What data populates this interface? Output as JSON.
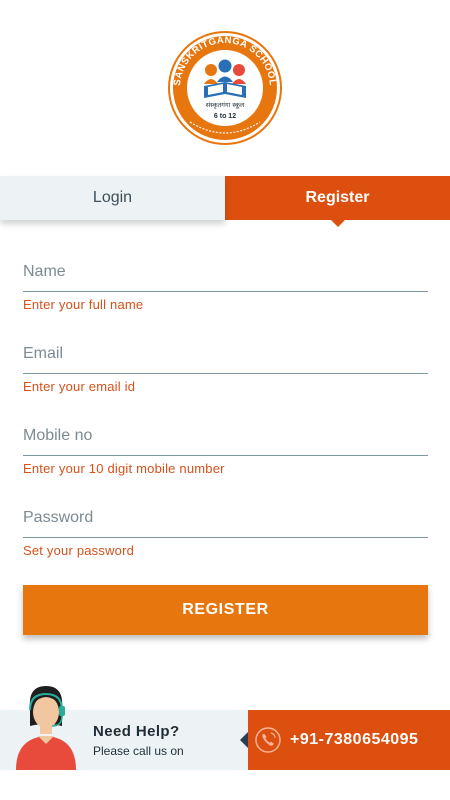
{
  "logo": {
    "ring_text": "SANSKRITGANGA SCHOOL",
    "hindi_name": "संस्कृतगंगा स्कूल",
    "grades": "6 to 12",
    "colors": {
      "ring": "#e8760f",
      "blue": "#2a6fb5"
    }
  },
  "tabs": [
    {
      "label": "Login",
      "active": false
    },
    {
      "label": "Register",
      "active": true
    }
  ],
  "form": {
    "fields": [
      {
        "placeholder": "Name",
        "value": "",
        "hint": "Enter your full name"
      },
      {
        "placeholder": "Email",
        "value": "",
        "hint": "Enter your email id"
      },
      {
        "placeholder": "Mobile no",
        "value": "",
        "hint": "Enter your 10 digit mobile number"
      },
      {
        "placeholder": "Password",
        "value": "",
        "hint": "Set your password"
      }
    ],
    "submit_label": "REGISTER"
  },
  "help": {
    "title": "Need Help?",
    "subtitle": "Please call us on",
    "phone": "+91-7380654095"
  },
  "colors": {
    "accent": "#dc4f0e",
    "button": "#e8760f",
    "hint": "#d8501a",
    "tab_inactive_bg": "#edf3f4"
  },
  "icons": [
    "school-logo",
    "headset-agent-icon",
    "phone-icon"
  ]
}
